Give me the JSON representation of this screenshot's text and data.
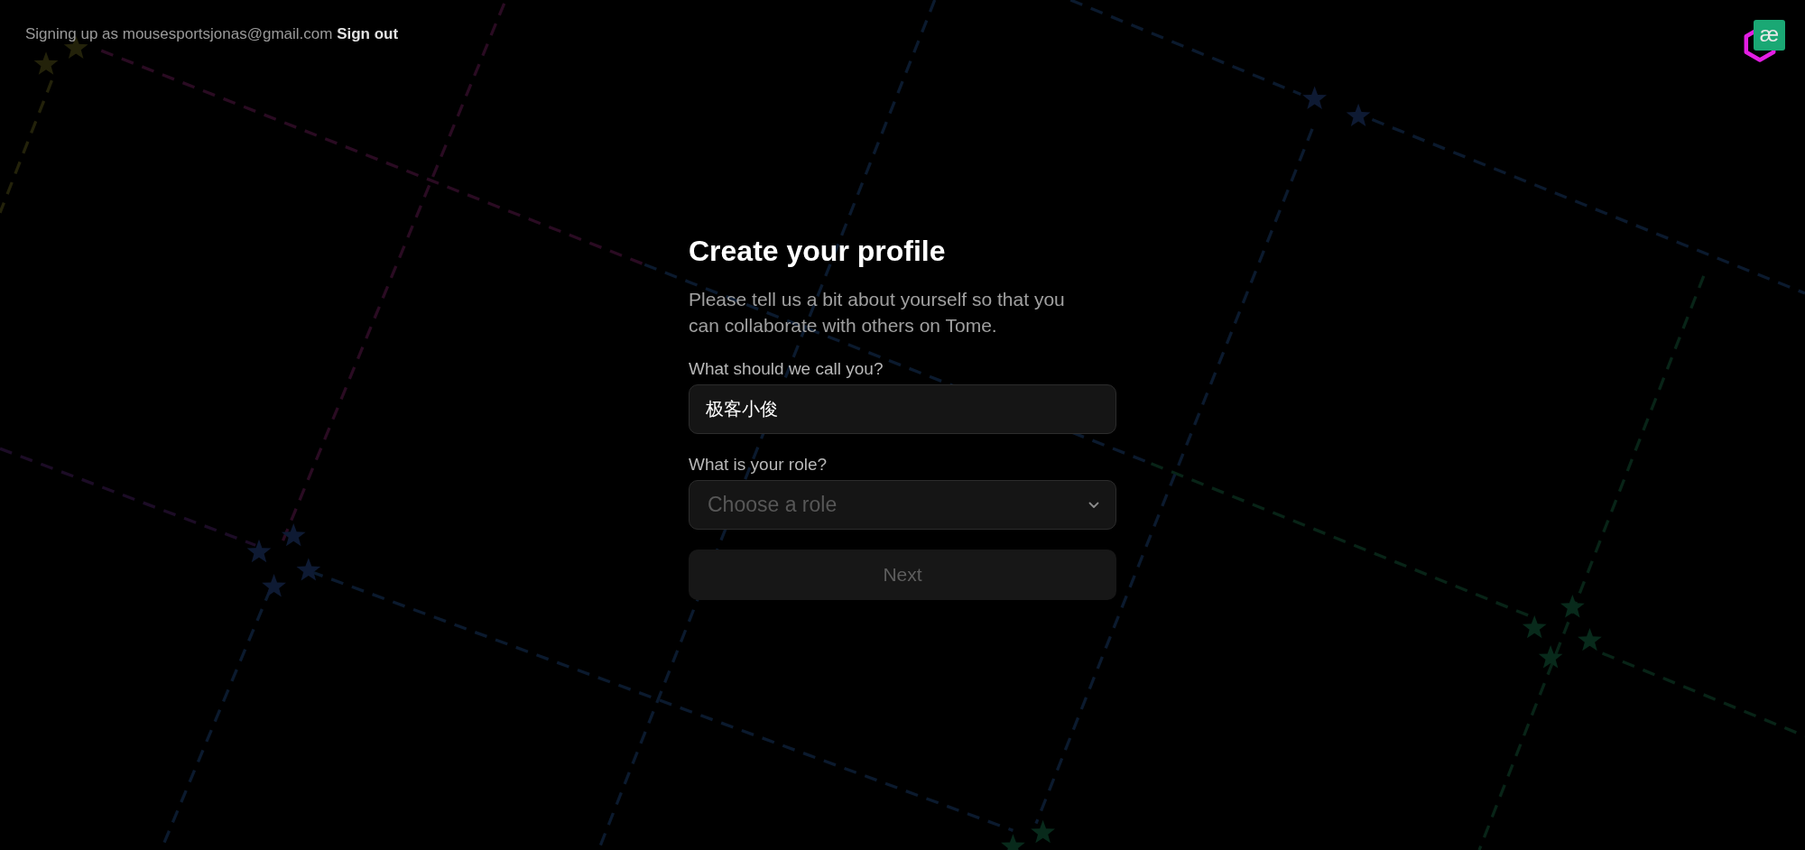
{
  "header": {
    "status_text": "Signing up as mousesportsjonas@gmail.com",
    "sign_out_link": "Sign out"
  },
  "avatar": {
    "text": "æ"
  },
  "form": {
    "title": "Create your profile",
    "description": "Please tell us a bit about yourself so that you can collaborate with others on Tome.",
    "fields": [
      {
        "kind": "text",
        "label": "What should we call you?",
        "value": "极客小俊"
      },
      {
        "kind": "select",
        "label": "What is your role?",
        "placeholder": "Choose a role"
      }
    ],
    "submit": {
      "label": "Next",
      "disabled": true
    }
  }
}
